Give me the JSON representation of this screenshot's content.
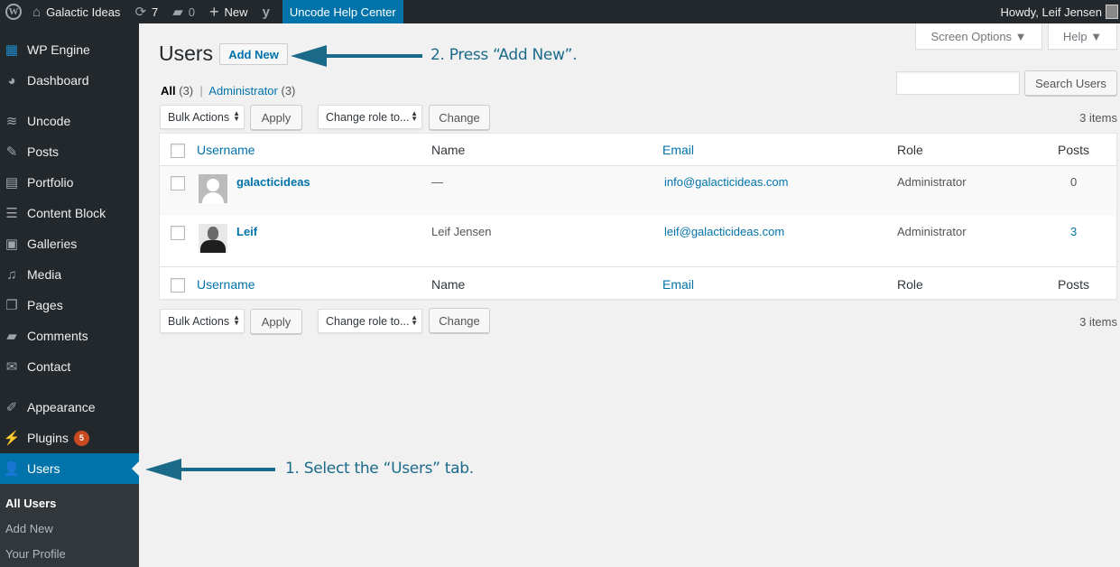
{
  "adminbar": {
    "site_name": "Galactic Ideas",
    "updates_count": "7",
    "comments_count": "0",
    "new_label": "New",
    "help_center_label": "Uncode Help Center",
    "greeting": "Howdy, Leif Jensen"
  },
  "sidebar": {
    "items": [
      {
        "label": "WP Engine",
        "icon": "wp-engine-icon"
      },
      {
        "label": "Dashboard",
        "icon": "dashboard-icon"
      },
      {
        "label": "Uncode",
        "icon": "layers-icon"
      },
      {
        "label": "Posts",
        "icon": "pin-icon"
      },
      {
        "label": "Portfolio",
        "icon": "grid-icon"
      },
      {
        "label": "Content Block",
        "icon": "block-icon"
      },
      {
        "label": "Galleries",
        "icon": "gallery-icon"
      },
      {
        "label": "Media",
        "icon": "media-icon"
      },
      {
        "label": "Pages",
        "icon": "pages-icon"
      },
      {
        "label": "Comments",
        "icon": "comment-icon"
      },
      {
        "label": "Contact",
        "icon": "mail-icon"
      },
      {
        "label": "Appearance",
        "icon": "brush-icon"
      },
      {
        "label": "Plugins",
        "icon": "plug-icon",
        "badge": "5"
      },
      {
        "label": "Users",
        "icon": "user-icon",
        "active": true
      }
    ],
    "submenu": [
      {
        "label": "All Users",
        "current": true
      },
      {
        "label": "Add New"
      },
      {
        "label": "Your Profile"
      }
    ]
  },
  "screen_meta": {
    "screen_options_label": "Screen Options ▼",
    "help_label": "Help ▼"
  },
  "page": {
    "title": "Users",
    "add_new_label": "Add New",
    "filters": {
      "all_label": "All",
      "all_count": "(3)",
      "separator": "|",
      "admin_label": "Administrator",
      "admin_count": "(3)"
    },
    "search": {
      "value": "",
      "button_label": "Search Users"
    },
    "bulk_actions_label": "Bulk Actions",
    "apply_label": "Apply",
    "change_role_label": "Change role to...",
    "change_label": "Change",
    "items_count": "3 items"
  },
  "table": {
    "columns": [
      "Username",
      "Name",
      "Email",
      "Role",
      "Posts"
    ],
    "rows": [
      {
        "username": "galacticideas",
        "name": "—",
        "email": "info@galacticideas.com",
        "role": "Administrator",
        "posts": "0"
      },
      {
        "username": "Leif",
        "name": "Leif Jensen",
        "email": "leif@galacticideas.com",
        "role": "Administrator",
        "posts": "3"
      }
    ]
  },
  "annotations": {
    "step1": "1. Select the “Users” tab.",
    "step2": "2. Press “Add New”.",
    "color": "#1b6a8a"
  }
}
